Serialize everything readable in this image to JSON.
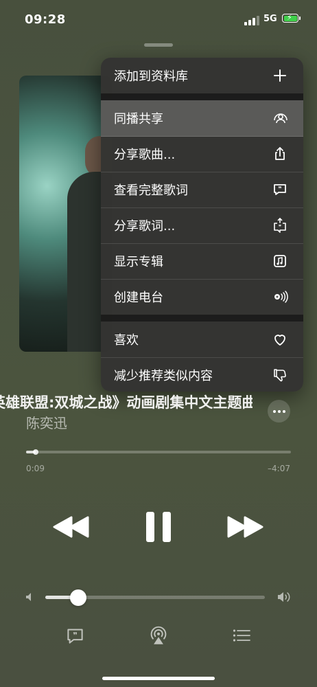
{
  "status": {
    "time": "09:28",
    "network": "5G",
    "signal_bars": 3,
    "battery_charging": true
  },
  "menu": {
    "items": [
      {
        "label": "添加到资料库",
        "icon": "plus-icon"
      },
      {
        "label": "同播共享",
        "icon": "shareplay-icon",
        "highlighted": true
      },
      {
        "label": "分享歌曲...",
        "icon": "share-icon"
      },
      {
        "label": "查看完整歌词",
        "icon": "lyrics-bubble-icon"
      },
      {
        "label": "分享歌词...",
        "icon": "share-lyrics-icon"
      },
      {
        "label": "显示专辑",
        "icon": "music-note-square-icon"
      },
      {
        "label": "创建电台",
        "icon": "radio-station-icon"
      },
      {
        "label": "喜欢",
        "icon": "heart-icon"
      },
      {
        "label": "减少推荐类似内容",
        "icon": "thumbs-down-icon"
      }
    ]
  },
  "song": {
    "title": "《英雄联盟:双城之战》动画剧集中文主题曲",
    "artist": "陈奕迅"
  },
  "playback": {
    "elapsed": "0:09",
    "remaining": "–4:07",
    "progress_fraction": 0.035,
    "is_playing": true
  },
  "volume": {
    "level_fraction": 0.15
  },
  "bottom_bar": {
    "lyrics_icon": "lyrics-bubble-icon",
    "airplay_icon": "airplay-icon",
    "queue_icon": "queue-list-icon"
  },
  "colors": {
    "battery": "#3fd14a",
    "menu_bg": "#343432",
    "menu_highlight": "#5a5a58"
  }
}
